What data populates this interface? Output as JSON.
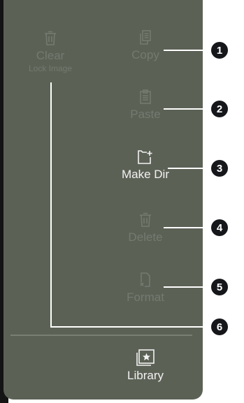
{
  "buttons": {
    "clear": {
      "label": "Clear",
      "sublabel": "Lock Image",
      "icon": "trash-icon"
    },
    "copy": {
      "label": "Copy",
      "icon": "copy-icon"
    },
    "paste": {
      "label": "Paste",
      "icon": "paste-icon"
    },
    "make_dir": {
      "label": "Make Dir",
      "icon": "new-folder-icon"
    },
    "delete": {
      "label": "Delete",
      "icon": "trash-icon"
    },
    "format": {
      "label": "Format",
      "icon": "format-icon"
    },
    "library": {
      "label": "Library",
      "icon": "star-image-icon"
    }
  },
  "callouts": [
    "1",
    "2",
    "3",
    "4",
    "5",
    "6"
  ],
  "colors": {
    "panel": "#5c6156",
    "disabled_text": "#757a70",
    "enabled_text": "#f2f2f2",
    "badge": "#15171a",
    "callout_line": "#ffffff"
  }
}
